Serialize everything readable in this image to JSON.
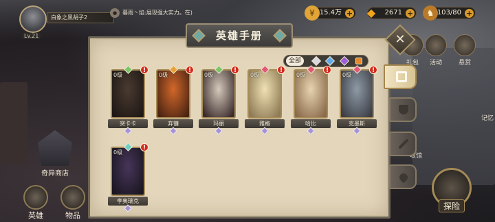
{
  "profile": {
    "level": "Lv.21",
    "name": "白象之黑胡子2"
  },
  "chat": {
    "icon": "●",
    "text": "暮雨丶焰:展现强大实力。在)"
  },
  "currencies": [
    {
      "name": "gold",
      "value": "15.4万",
      "icon": "gold-coin-icon",
      "color": "#e0a437"
    },
    {
      "name": "diamond",
      "value": "2671",
      "icon": "diamond-icon",
      "color": "#f2a51a"
    },
    {
      "name": "stamina",
      "value": "103/80",
      "icon": "stamina-icon",
      "color": "#d9892a"
    }
  ],
  "side_menu": {
    "gift": "礼包",
    "activity": "活动",
    "bounty": "悬赏",
    "records": "记忆",
    "gallery": "收馆"
  },
  "shop": {
    "label": "奇异商店"
  },
  "bottom_nav": {
    "heroes": "英雄",
    "items": "物品"
  },
  "explore": {
    "label": "探险"
  },
  "panel": {
    "title": "英雄手册",
    "close": "✕"
  },
  "filter": {
    "all": "全部",
    "gems": [
      "#d9d9e3",
      "#5fa9e8",
      "#9b5fd6",
      "#e58a2b"
    ]
  },
  "heroes": [
    {
      "level": "0级",
      "name": "突卡卡",
      "rarity_color": "#7ec46a",
      "art": [
        "#4a3a30",
        "#1e1815"
      ]
    },
    {
      "level": "0级",
      "name": "弃镰",
      "rarity_color": "#e8a136",
      "art": [
        "#d2672a",
        "#4a2412"
      ]
    },
    {
      "level": "0级",
      "name": "玛丽",
      "rarity_color": "#7ec46a",
      "art": [
        "#d4c9bb",
        "#3a2b2b"
      ]
    },
    {
      "level": "0级",
      "name": "雅格",
      "rarity_color": "#e05a78",
      "art": [
        "#efe1b3",
        "#8e7a55"
      ]
    },
    {
      "level": "0级",
      "name": "哈比",
      "rarity_color": "#e05a78",
      "art": [
        "#e7d3b0",
        "#8a6a4a"
      ]
    },
    {
      "level": "0级",
      "name": "克墨斯",
      "rarity_color": "#e05a78",
      "art": [
        "#8d9aa6",
        "#3d3e45"
      ]
    },
    {
      "level": "0级",
      "name": "李奥瑞克",
      "rarity_color": "#6fcfc2",
      "art": [
        "#47355a",
        "#1a1620"
      ]
    }
  ],
  "alert": "!"
}
